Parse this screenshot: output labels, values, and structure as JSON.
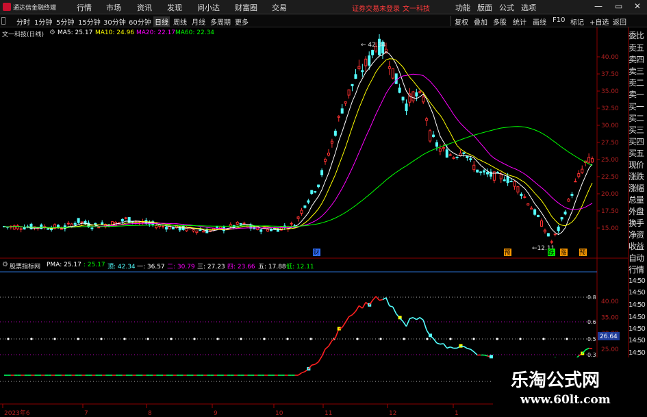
{
  "titlebar": {
    "app_title": "通达信金融终端",
    "menus": [
      "行情",
      "市场",
      "资讯",
      "发现",
      "问小达",
      "财富圈",
      "交易"
    ],
    "warning": "证券交易未登录",
    "stock_title": "文一科技",
    "tools": [
      "功能",
      "版面",
      "公式",
      "选项"
    ],
    "window_controls": [
      "—",
      "▭",
      "✕"
    ]
  },
  "periodbar": {
    "periods": [
      "分时",
      "1分钟",
      "5分钟",
      "15分钟",
      "30分钟",
      "60分钟",
      "日线",
      "周线",
      "月线",
      "多周期",
      "更多"
    ],
    "selected": "日线",
    "right_buttons": [
      "复权",
      "叠加",
      "多股",
      "统计",
      "画线",
      "F10",
      "标记",
      "+自选",
      "返回"
    ]
  },
  "main_chart": {
    "title": "文一科技(日线)",
    "ma5": "MA5: 25.17",
    "ma10": "MA10: 24.96",
    "ma20": "MA20: 22.17",
    "ma60": "MA60: 22.34",
    "high_label": "42.34",
    "low_label": "12.11",
    "price_ticks": [
      "40.00",
      "37.50",
      "35.00",
      "32.50",
      "30.00",
      "27.50",
      "25.00",
      "22.50",
      "20.00",
      "17.50",
      "15.00"
    ],
    "event_markers": [
      "财",
      "预",
      "跌",
      "涨",
      "预"
    ],
    "colors": {
      "up": "#ff3232",
      "down": "#54ffff",
      "ma5": "#ffffff",
      "ma10": "#ffff00",
      "ma20": "#ff00ff",
      "ma60": "#00ff00",
      "axis": "#a00000"
    }
  },
  "right_tabs": [
    "委比",
    "卖五",
    "卖四",
    "卖三",
    "卖二",
    "卖一",
    "买一",
    "买二",
    "买三",
    "买四",
    "买五",
    "现价",
    "涨跌",
    "涨幅",
    "总量",
    "外盘",
    "换手",
    "净资",
    "收益",
    "自动",
    "行情",
    "14:50",
    "14:50",
    "14:50",
    "14:50",
    "14:50",
    "14:50",
    "14:50"
  ],
  "lower_chart": {
    "title": "股票指标网",
    "pma": "PMA: 25.17",
    "v1": ": 25.17",
    "top": "顶: 42.34",
    "one": "一: 36.57",
    "two": "二: 30.79",
    "three": "三: 27.23",
    "four": "四: 23.66",
    "five": "五: 17.88",
    "low": "低: 12.11",
    "price_ticks": [
      "40.00",
      "35.00",
      "30.00",
      "25.00"
    ],
    "level_labels": [
      "0.8",
      "0.6",
      "0.5",
      "0.3"
    ],
    "current_badge": "26.64"
  },
  "date_axis": [
    "2023年6",
    "7",
    "8",
    "9",
    "10",
    "11",
    "12",
    "1"
  ],
  "watermark": {
    "line1": "乐淘公式网",
    "line2": "www.60lt.com"
  }
}
